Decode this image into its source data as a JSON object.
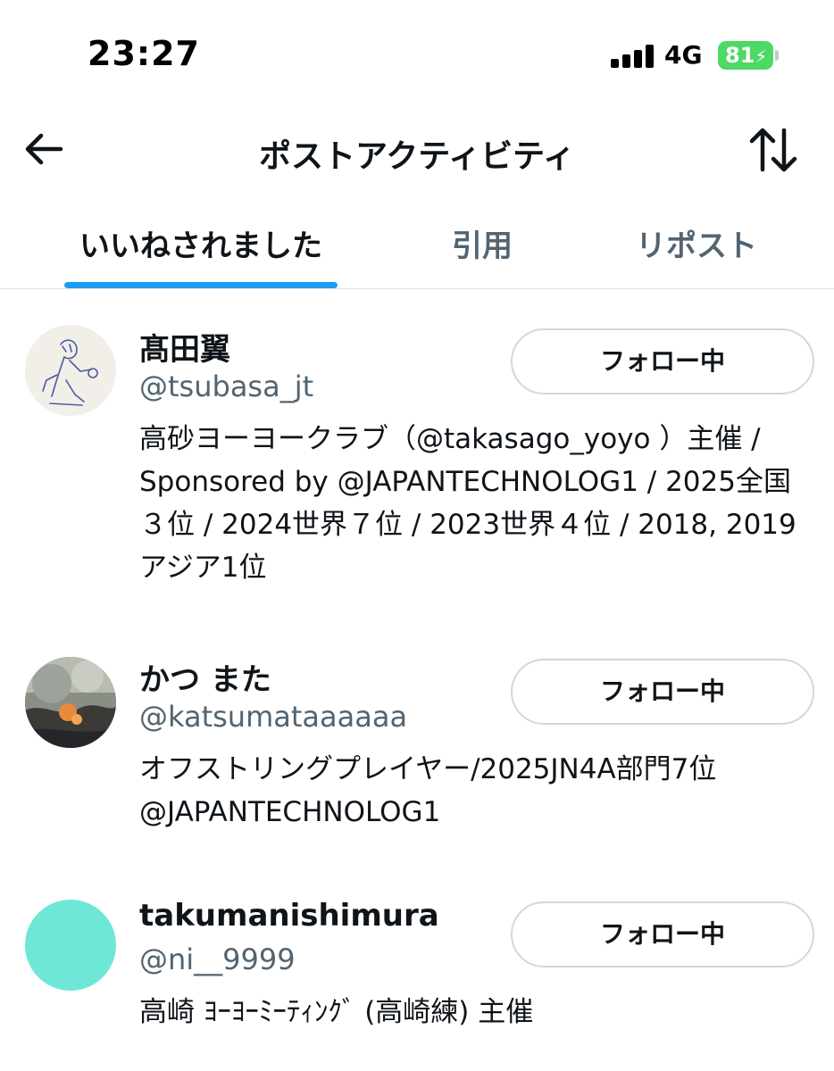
{
  "status_bar": {
    "time": "23:27",
    "network": "4G",
    "battery": "81"
  },
  "header": {
    "title": "ポストアクティビティ",
    "back_icon": "arrow-left-icon",
    "sort_icon": "sort-arrows-icon"
  },
  "tabs": [
    {
      "label": "いいねされました",
      "active": true
    },
    {
      "label": "引用",
      "active": false
    },
    {
      "label": "リポスト",
      "active": false
    }
  ],
  "colors": {
    "accent": "#1d9bf0",
    "battery": "#4cd964",
    "secondary_text": "#536471",
    "avatar_3": "#6ee7d6"
  },
  "users": [
    {
      "name": "髙田翼",
      "handle": "@tsubasa_jt",
      "bio": "高砂ヨーヨークラブ（@takasago_yoyo ）主催 / Sponsored by @JAPANTECHNOLOG1 / 2025全国３位 / 2024世界７位 / 2023世界４位 / 2018, 2019アジア1位",
      "button": "フォロー中"
    },
    {
      "name": "かつ また",
      "handle": "@katsumataaaaaa",
      "bio": "オフストリングプレイヤー/2025JN4A部門7位@JAPANTECHNOLOG1",
      "button": "フォロー中"
    },
    {
      "name": "takumanishimura",
      "handle": "@ni__9999",
      "bio": "高崎 ﾖｰﾖｰﾐｰﾃｨﾝｸﾞ (高崎練) 主催",
      "button": "フォロー中"
    }
  ]
}
